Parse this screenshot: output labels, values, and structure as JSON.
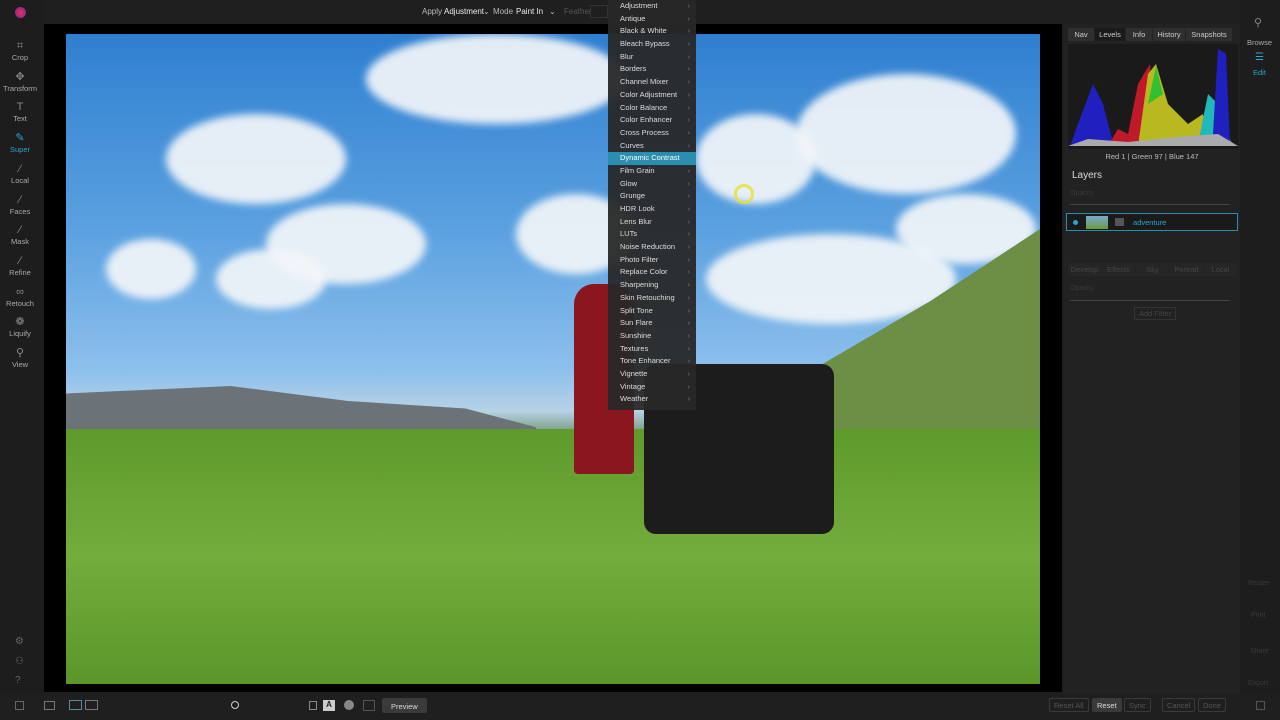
{
  "topbar": {
    "apply_label": "Apply",
    "apply_value": "Adjustment",
    "mode_label": "Mode",
    "mode_value": "Paint In",
    "feather_label": "Feather"
  },
  "tools": [
    {
      "label": "Crop",
      "icon": "crop-icon",
      "glyph": "⌗"
    },
    {
      "label": "Transform",
      "icon": "move-icon",
      "glyph": "✥"
    },
    {
      "label": "Text",
      "icon": "text-icon",
      "glyph": "T"
    },
    {
      "label": "Super",
      "icon": "brush-icon",
      "glyph": "✎"
    },
    {
      "label": "Local",
      "icon": "local-brush-icon",
      "glyph": "⁄"
    },
    {
      "label": "Faces",
      "icon": "faces-icon",
      "glyph": "⁄"
    },
    {
      "label": "Mask",
      "icon": "mask-icon",
      "glyph": "⁄"
    },
    {
      "label": "Refine",
      "icon": "refine-icon",
      "glyph": "⁄"
    },
    {
      "label": "Retouch",
      "icon": "retouch-icon",
      "glyph": "∞"
    },
    {
      "label": "Liquify",
      "icon": "liquify-icon",
      "glyph": "❁"
    },
    {
      "label": "View",
      "icon": "zoom-icon",
      "glyph": "⚲"
    }
  ],
  "menu": {
    "selected": "Dynamic Contrast",
    "items": [
      "Adjustment",
      "Antique",
      "Black & White",
      "Bleach Bypass",
      "Blur",
      "Borders",
      "Channel Mixer",
      "Color Adjustment",
      "Color Balance",
      "Color Enhancer",
      "Cross Process",
      "Curves",
      "Dynamic Contrast",
      "Film Grain",
      "Glow",
      "Grunge",
      "HDR Look",
      "Lens Blur",
      "LUTs",
      "Noise Reduction",
      "Photo Filter",
      "Replace Color",
      "Sharpening",
      "Skin Retouching",
      "Split Tone",
      "Sun Flare",
      "Sunshine",
      "Textures",
      "Tone Enhancer",
      "Vignette",
      "Vintage",
      "Weather"
    ]
  },
  "panel": {
    "tabs": [
      "Nav",
      "Levels",
      "Info",
      "History",
      "Snapshots"
    ],
    "active_tab": "Levels",
    "readout": "Red   1   | Green  97   | Blue  147",
    "layers_title": "Layers",
    "opacity_label": "Opacity",
    "layer_name": "adventure",
    "filter_tabs": [
      "Develop",
      "Effects",
      "Sky",
      "Portrait",
      "Local"
    ],
    "opacity2_label": "Opacity",
    "add_filter": "Add Filter"
  },
  "farright": {
    "browse": "Browse",
    "edit": "Edit",
    "resize": "Resize",
    "print": "Print",
    "share": "Share",
    "export": "Export"
  },
  "bottom": {
    "preview": "Preview",
    "reset_all": "Reset All",
    "reset": "Reset",
    "sync": "Sync",
    "cancel": "Cancel",
    "done": "Done"
  }
}
